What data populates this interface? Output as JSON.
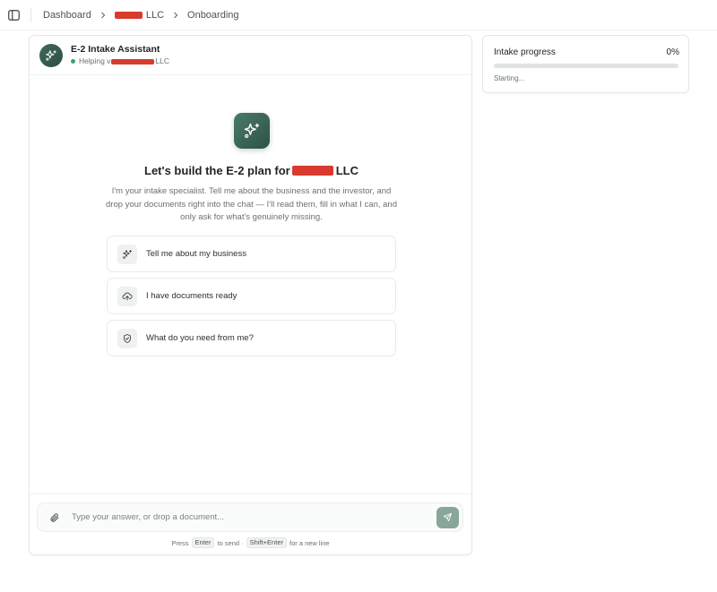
{
  "breadcrumb": {
    "items": [
      "Dashboard",
      "LLC",
      "Onboarding"
    ]
  },
  "assistant": {
    "name": "E-2 Intake Assistant",
    "status_prefix": "Helping v",
    "status_suffix": "LLC"
  },
  "hero": {
    "title_prefix": "Let's build the E-2 plan for",
    "title_suffix": "LLC",
    "description": "I'm your intake specialist. Tell me about the business and the investor, and drop your documents right into the chat — I'll read them, fill in what I can, and only ask for what's genuinely missing."
  },
  "suggestions": [
    {
      "label": "Tell me about my business",
      "icon": "sparkle-icon"
    },
    {
      "label": "I have documents ready",
      "icon": "upload-cloud-icon"
    },
    {
      "label": "What do you need from me?",
      "icon": "shield-icon"
    }
  ],
  "composer": {
    "placeholder": "Type your answer, or drop a document...",
    "hint": {
      "press": "Press",
      "key_send": "Enter",
      "to_send": "to send ·",
      "key_newline": "Shift+Enter",
      "for_newline": "for a new line"
    }
  },
  "progress": {
    "label": "Intake progress",
    "percent_text": "0%",
    "value": 0,
    "status": "Starting..."
  },
  "colors": {
    "accent": "#3e6a59",
    "send_button": "#88a699",
    "redaction": "#d83a2d",
    "status_online": "#3fa36b"
  }
}
